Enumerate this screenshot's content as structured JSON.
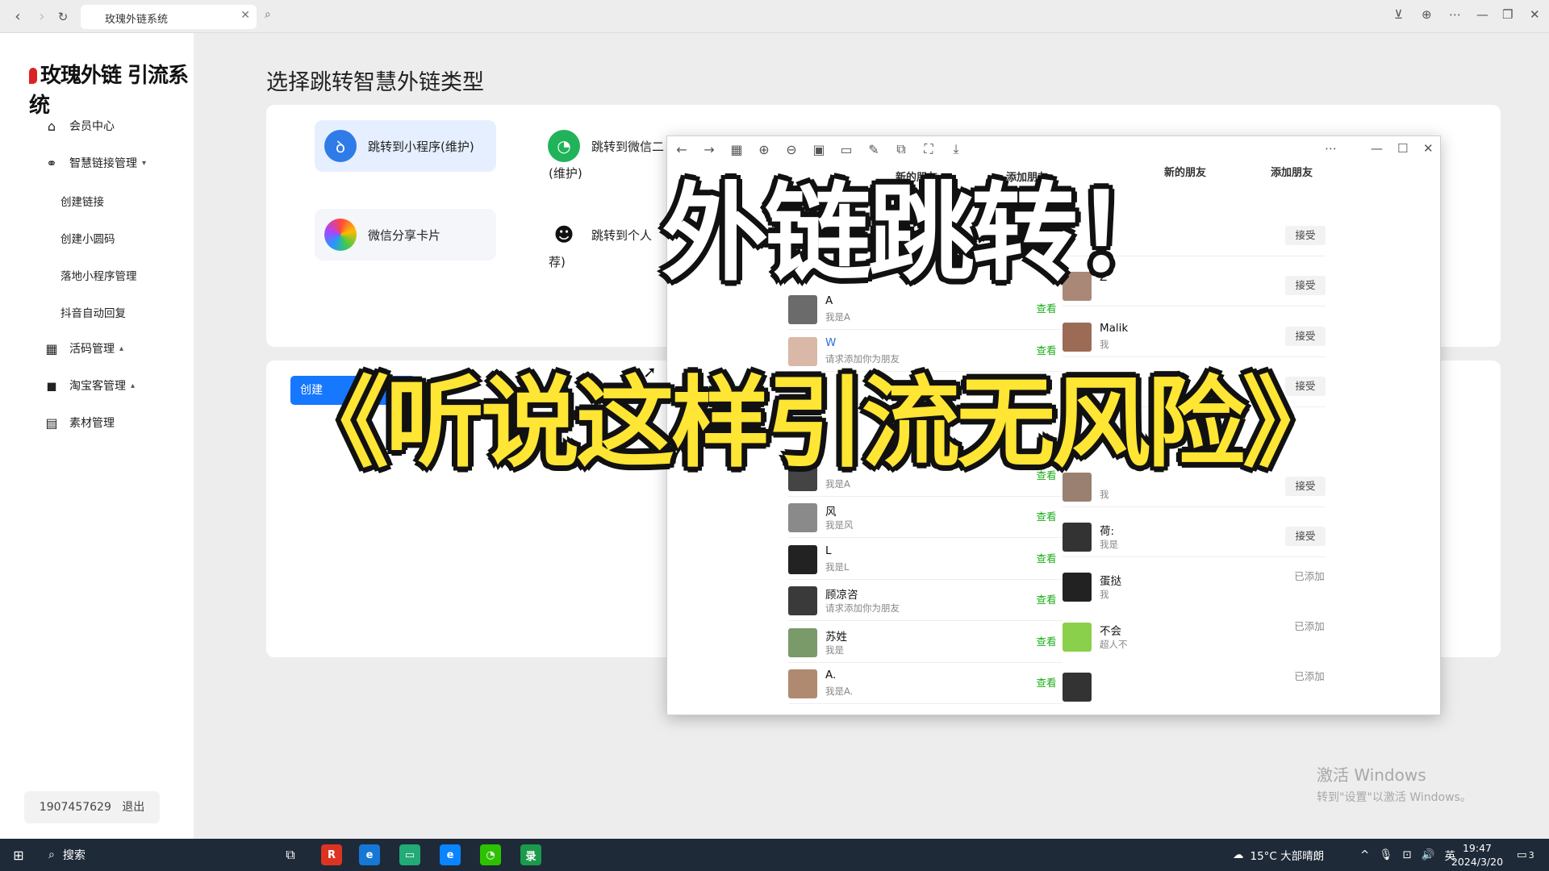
{
  "browser": {
    "tab_title": "玫瑰外链系统"
  },
  "sidebar": {
    "logo": "玫瑰外链 引流系统",
    "menu": {
      "member_center": "会员中心",
      "smart_link": "智慧链接管理",
      "create_link": "创建链接",
      "create_mini_code": "创建小圆码",
      "landing_mini": "落地小程序管理",
      "douyin_reply": "抖音自动回复",
      "live_code": "活码管理",
      "taobao": "淘宝客管理",
      "material": "素材管理"
    },
    "account_id": "1907457629",
    "logout": "退出"
  },
  "main": {
    "page_title": "选择跳转智慧外链类型",
    "options": {
      "mini_program": "跳转到小程序(维护)",
      "wechat_line1": "跳转到微信二",
      "wechat_line2": "(维护)",
      "share_card": "微信分享卡片",
      "personal_line1": "跳转到个人",
      "personal_line2": "荐)"
    },
    "create_button": "创建"
  },
  "viewer": {
    "left_header_new": "新的朋友",
    "left_header_add": "添加朋友",
    "right_header_new": "新的朋友",
    "right_header_add": "添加朋友",
    "left_contacts": [
      {
        "name": "A",
        "sub": "我是A",
        "btn": "查看"
      },
      {
        "name": "W",
        "sub": "请求添加你为朋友",
        "btn": "查看"
      },
      {
        "name": "",
        "sub": "我是A",
        "btn": "查看"
      },
      {
        "name": "风",
        "sub": "我是风",
        "btn": "查看"
      },
      {
        "name": "L",
        "sub": "我是L",
        "btn": "查看"
      },
      {
        "name": "顾凉咨",
        "sub": "请求添加你为朋友",
        "btn": "查看"
      },
      {
        "name": "苏姓",
        "sub": "我是",
        "btn": "查看"
      },
      {
        "name": "A.",
        "sub": "我是A.",
        "btn": "查看"
      }
    ],
    "right_contacts": [
      {
        "name": "",
        "sub": "",
        "btn": "接受"
      },
      {
        "name": "Z",
        "sub": "",
        "btn": "接受"
      },
      {
        "name": "Malik",
        "sub": "我",
        "btn": "接受"
      },
      {
        "name": "",
        "sub": "",
        "btn": "接受"
      },
      {
        "name": "",
        "sub": "我",
        "btn": "接受"
      },
      {
        "name": "荷:",
        "sub": "我是",
        "btn": "接受"
      },
      {
        "name": "蛋挞",
        "sub": "我",
        "btn": "已添加"
      },
      {
        "name": "不会",
        "sub": "超人不",
        "btn": "已添加"
      },
      {
        "name": "",
        "sub": "",
        "btn": "已添加"
      }
    ]
  },
  "overlay": {
    "caption_top": "外链跳转！",
    "caption_bottom": "《听说这样引流无风险》"
  },
  "watermark": {
    "line1": "激活 Windows",
    "line2": "转到\"设置\"以激活 Windows。"
  },
  "taskbar": {
    "search": "搜索",
    "weather": "15°C 大部晴朗",
    "ime": "英",
    "time": "19:47",
    "date": "2024/3/20",
    "notifications": "3"
  },
  "colors": {
    "accent": "#1677ff",
    "caption_yellow": "#ffe534",
    "wechat_green": "#1aad19"
  }
}
